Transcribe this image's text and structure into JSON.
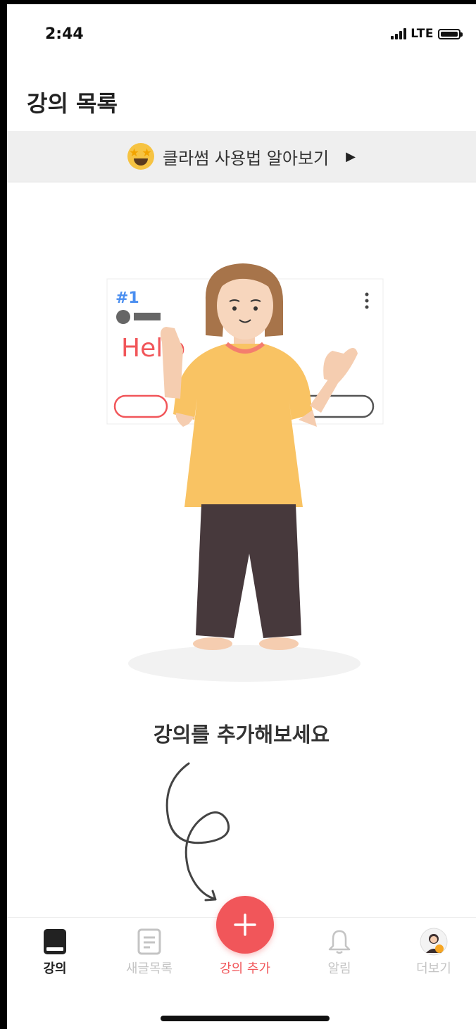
{
  "status_bar": {
    "time": "2:44",
    "network": "LTE"
  },
  "header": {
    "title": "강의 목록"
  },
  "guide_banner": {
    "label": "클라썸 사용법 알아보기",
    "icon": "star-eyes-emoji-icon"
  },
  "illustration": {
    "card_number": "#1",
    "card_text": "Hello"
  },
  "empty_state": {
    "message": "강의를 추가해보세요"
  },
  "tabbar": {
    "tabs": [
      {
        "label": "강의",
        "icon": "book-icon",
        "active": true
      },
      {
        "label": "새글목록",
        "icon": "document-list-icon",
        "active": false
      },
      {
        "label": "강의 추가",
        "icon": "plus-icon",
        "active": false
      },
      {
        "label": "알림",
        "icon": "bell-icon",
        "active": false
      },
      {
        "label": "더보기",
        "icon": "avatar-icon",
        "active": false
      }
    ]
  },
  "colors": {
    "accent": "#f1565a",
    "card_number": "#4a8ef0",
    "shirt": "#f9c363",
    "pants": "#47393c"
  }
}
